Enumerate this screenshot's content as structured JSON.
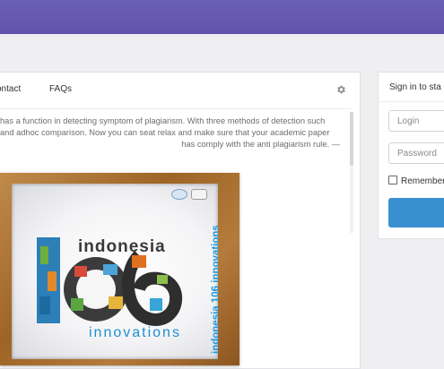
{
  "tabs": [
    "ontact",
    "FAQs"
  ],
  "icons": {
    "settings": "gear-icon"
  },
  "description_lines": [
    "has a function in detecting symptom of plagiarism. With three methods of detection such",
    "and adhoc comparison. Now you can seat relax and make sure that your academic paper",
    "has comply with the anti plagiarism rule. —"
  ],
  "banner": {
    "word_top": "indonesia",
    "word_bottom": "innovations",
    "vertical_text": "indonesia 106 innovations"
  },
  "signin": {
    "title": "Sign in to sta",
    "login_placeholder": "Login",
    "password_placeholder": "Password",
    "remember_label": "Remember"
  },
  "colors": {
    "header": "#6253ac",
    "accent_button": "#3a8fce",
    "frame": "#9d6426",
    "banner_text": "#1c9be0"
  }
}
